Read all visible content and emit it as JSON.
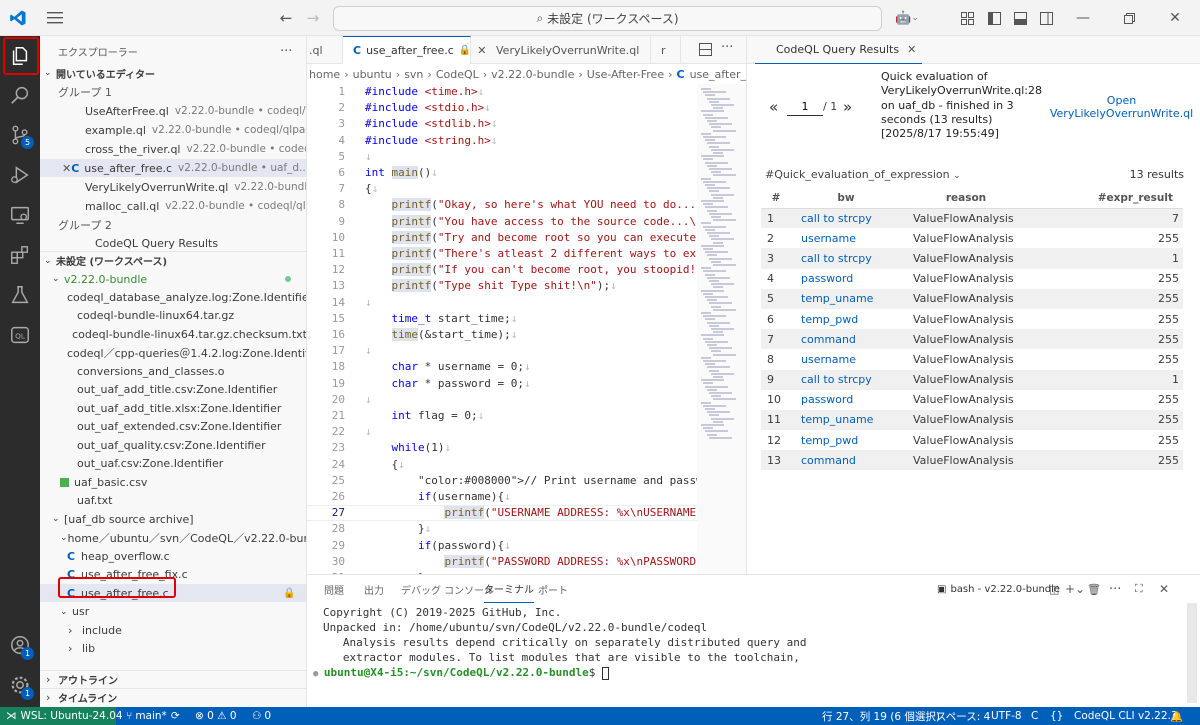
{
  "titlebar": {
    "search_text": "未設定 (ワークスペース)"
  },
  "activity": {
    "scm_badge": "5",
    "accounts_badge": "1",
    "manage_badge": "1"
  },
  "sidebar": {
    "title": "エクスプローラー",
    "open_editors": "開いているエディター",
    "group1": "グループ 1",
    "group2": "グループ 2",
    "open_files": [
      {
        "name": "UseAfterFree.ql",
        "desc": "v2.22.0-bundle • codeql/qlpa..."
      },
      {
        "name": "example.ql",
        "desc": "v2.22.0-bundle • codeql/qlpacks/c..."
      },
      {
        "name": "cross_the_river.ql",
        "desc": "v2.22.0-bundle • codeql/ql..."
      },
      {
        "name": "use_after_free.c",
        "desc": "v2.22.0-bundle • uaf_d..."
      },
      {
        "name": "VeryLikelyOverrunWrite.ql",
        "desc": "v2.22.0-bundle ..."
      },
      {
        "name": "malloc_call.ql",
        "desc": "v2.22.0-bundle • codeql/qlpack..."
      }
    ],
    "group2_item": "CodeQL Query Results",
    "workspace": "未設定 (ワークスペース)",
    "root_folder": "v2.22.0-bundle",
    "files": [
      "codeql_database_analyze.log:Zone.Identifier",
      "codeql-bundle-linux64.tar.gz",
      "codeql-bundle-linux64.tar.gz.checksum.txt",
      "codeql／cpp-queries＠1.4.2.log:Zone.Identifier",
      "conversions_and_classes.o",
      "out_uaf_add_title.csv:Zone.Identifier",
      "out_uaf_add_title.xlsx:Zone.Identifier",
      "out_uaf_extended.csv:Zone.Identifier",
      "out_uaf_quality.csv:Zone.Identifier",
      "out_uaf.csv:Zone.Identifier",
      "uaf_basic.csv",
      "uaf.txt"
    ],
    "archive": "[uaf_db source archive]",
    "archive_path": "home／ubuntu／svn／CodeQL／v2.22.0-bundle...",
    "archive_files": [
      "heap_overflow.c",
      "use_after_free_fix.c",
      "use_after_free.c"
    ],
    "usr": "usr",
    "include": "include",
    "lib": "lib",
    "outline": "アウトライン",
    "timeline": "タイムライン"
  },
  "editor": {
    "tab_prev": ".ql",
    "tab_active": "use_after_free.c",
    "tab_next": "VeryLikelyOverrunWrite.ql",
    "tab_cut": "r",
    "breadcrumb": [
      "home",
      "ubuntu",
      "svn",
      "CodeQL",
      "v2.22.0-bundle",
      "Use-After-Free",
      "use_after_free.c"
    ],
    "lines": [
      {
        "n": "1",
        "t": "#include <time.h>↓"
      },
      {
        "n": "2",
        "t": "#include <stdio.h>↓"
      },
      {
        "n": "3",
        "t": "#include <stdlib.h>↓"
      },
      {
        "n": "4",
        "t": "#include <string.h>↓"
      },
      {
        "n": "5",
        "t": "↓"
      },
      {
        "n": "6",
        "t": "int main()↓"
      },
      {
        "n": "7",
        "t": "{↓"
      },
      {
        "n": "8",
        "t": "    printf(\"Okay, so here's what YOU need to do...\\"
      },
      {
        "n": "9",
        "t": "    printf(\"You have access to the source code...\\n"
      },
      {
        "n": "10",
        "t": "    printf(\"Try and become root so you can execute"
      },
      {
        "n": "11",
        "t": "    printf(\"There's atleast 2 different ways to exp"
      },
      {
        "n": "12",
        "t": "    printf(\"If you can't become root, you stoopid!\\"
      },
      {
        "n": "13",
        "t": "    printf(\"Type shit Type shit!\\n\");↓"
      },
      {
        "n": "14",
        "t": "↓"
      },
      {
        "n": "15",
        "t": "    time_t start_time;↓"
      },
      {
        "n": "16",
        "t": "    time(&start_time);↓"
      },
      {
        "n": "17",
        "t": "↓"
      },
      {
        "n": "18",
        "t": "    char * username = 0;↓"
      },
      {
        "n": "19",
        "t": "    char * password = 0;↓"
      },
      {
        "n": "20",
        "t": "↓"
      },
      {
        "n": "21",
        "t": "    int flag = 0;↓"
      },
      {
        "n": "22",
        "t": "↓"
      },
      {
        "n": "23",
        "t": "    while(1)↓"
      },
      {
        "n": "24",
        "t": "    {↓"
      },
      {
        "n": "25",
        "t": "        // Print username and password (with addres"
      },
      {
        "n": "26",
        "t": "        if(username){↓"
      },
      {
        "n": "27",
        "t": "            printf(\"USERNAME ADDRESS: %x\\nUSERNAME:"
      },
      {
        "n": "28",
        "t": "        }↓"
      },
      {
        "n": "29",
        "t": "        if(password){↓"
      },
      {
        "n": "30",
        "t": "            printf(\"PASSWORD ADDRESS: %x\\nPASSWORD:"
      },
      {
        "n": "31",
        "t": "        }↓"
      }
    ]
  },
  "results": {
    "tab": "CodeQL Query Results",
    "page_prev": "«",
    "page_next": "»",
    "page_value": "1",
    "page_total": "/ 1",
    "summary": "Quick evaluation of VeryLikelyOverrunWrite.ql:28 on uaf_db - finished in 3 seconds (13 results) [2025/8/17 19:55:49]",
    "open_link": "Open VeryLikelyOverrunWrite.ql",
    "select": "#Quick_evaluation_of_expression",
    "count": "13 results",
    "headers": [
      "#",
      "bw",
      "reason",
      "#expr_result"
    ],
    "rows": [
      [
        "1",
        "call to strcpy",
        "ValueFlowAnalysis",
        "7"
      ],
      [
        "2",
        "username",
        "ValueFlowAnalysis",
        "255"
      ],
      [
        "3",
        "call to strcpy",
        "ValueFlowAnalysis",
        "1"
      ],
      [
        "4",
        "password",
        "ValueFlowAnalysis",
        "255"
      ],
      [
        "5",
        "temp_uname",
        "ValueFlowAnalysis",
        "255"
      ],
      [
        "6",
        "temp_pwd",
        "ValueFlowAnalysis",
        "255"
      ],
      [
        "7",
        "command",
        "ValueFlowAnalysis",
        "255"
      ],
      [
        "8",
        "username",
        "ValueFlowAnalysis",
        "255"
      ],
      [
        "9",
        "call to strcpy",
        "ValueFlowAnalysis",
        "1"
      ],
      [
        "10",
        "password",
        "ValueFlowAnalysis",
        "255"
      ],
      [
        "11",
        "temp_uname",
        "ValueFlowAnalysis",
        "255"
      ],
      [
        "12",
        "temp_pwd",
        "ValueFlowAnalysis",
        "255"
      ],
      [
        "13",
        "command",
        "ValueFlowAnalysis",
        "255"
      ]
    ]
  },
  "panel": {
    "tabs": [
      "問題",
      "出力",
      "デバッグ コンソール",
      "ターミナル",
      "ポート"
    ],
    "terminal_name": "bash - v2.22.0-bundle",
    "lines": [
      "Copyright (C) 2019-2025 GitHub, Inc.",
      "Unpacked in: /home/ubuntu/svn/CodeQL/v2.22.0-bundle/codeql",
      "   Analysis results depend critically on separately distributed query and",
      "   extractor modules. To list modules that are visible to the toolchain,"
    ],
    "prompt": "ubuntu@X4-i5:~/svn/CodeQL/v2.22.0-bundle",
    "prompt_suffix": "$ "
  },
  "status": {
    "remote": "WSL: Ubuntu-24.04",
    "branch": "main*",
    "errors": "⊗ 0 ⚠ 0",
    "ports": "0",
    "position": "行 27、列 19 (6 個選択)",
    "spaces": "スペース: 4",
    "encoding": "UTF-8",
    "language": "C",
    "codeql": "CodeQL CLI v2.22.3"
  },
  "colors": {
    "accent": "#005fb8",
    "highlight_box": "#e00000"
  }
}
